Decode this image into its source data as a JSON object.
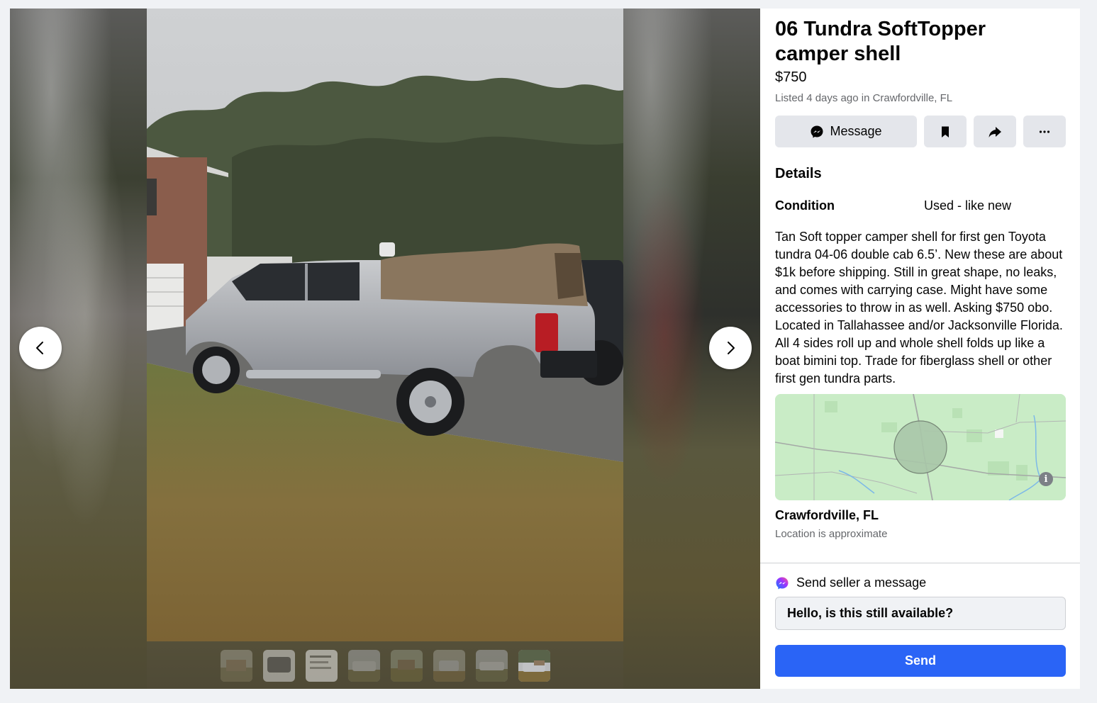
{
  "listing": {
    "title": "06 Tundra SoftTopper camper shell",
    "price": "$750",
    "listed_prefix": "Listed 4 days ago in ",
    "listed_location": "Crawfordville, FL"
  },
  "actions": {
    "message_label": "Message",
    "save_icon": "bookmark-icon",
    "share_icon": "share-icon",
    "more_icon": "more-icon"
  },
  "details": {
    "heading": "Details",
    "condition_label": "Condition",
    "condition_value": "Used - like new",
    "description": "Tan Soft topper camper shell for first gen Toyota tundra 04-06 double cab 6.5’. New these are about $1k before shipping. Still in great shape, no leaks, and comes with carrying case. Might have some accessories to throw in as well. Asking $750 obo. Located in Tallahassee and/or Jacksonville Florida. All 4 sides roll up and whole shell folds up like a boat bimini top. Trade for fiberglass shell or other first gen tundra parts."
  },
  "location": {
    "name": "Crawfordville, FL",
    "note": "Location is approximate",
    "info_glyph": "i"
  },
  "contact": {
    "label": "Send seller a message",
    "input_value": "Hello, is this still available?",
    "send_label": "Send"
  },
  "gallery": {
    "thumbnail_count": 8,
    "active_index": 7
  },
  "colors": {
    "primary": "#2a64f6",
    "secondary_button": "#e4e6eb",
    "muted_text": "#65676b"
  }
}
